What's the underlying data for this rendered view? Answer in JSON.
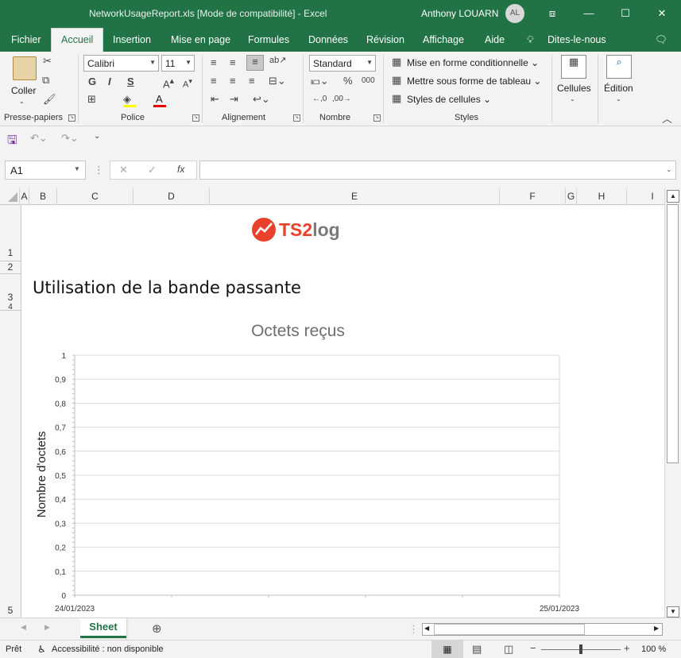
{
  "window": {
    "title": "NetworkUsageReport.xls  [Mode de compatibilité]  -  Excel",
    "user_name": "Anthony LOUARN",
    "user_initials": "AL"
  },
  "menu": {
    "tabs": [
      {
        "label": "Fichier"
      },
      {
        "label": "Accueil",
        "active": true
      },
      {
        "label": "Insertion"
      },
      {
        "label": "Mise en page"
      },
      {
        "label": "Formules"
      },
      {
        "label": "Données"
      },
      {
        "label": "Révision"
      },
      {
        "label": "Affichage"
      },
      {
        "label": "Aide"
      },
      {
        "label": "Dites-le-nous"
      }
    ]
  },
  "ribbon": {
    "clipboard": {
      "paste_label": "Coller",
      "group_label": "Presse-papiers"
    },
    "font": {
      "font_name": "Calibri",
      "font_size": "11",
      "bold": "G",
      "italic": "I",
      "underline": "S",
      "group_label": "Police"
    },
    "alignment": {
      "group_label": "Alignement"
    },
    "number": {
      "format": "Standard",
      "group_label": "Nombre"
    },
    "styles": {
      "conditional_label": "Mise en forme conditionnelle",
      "table_label": "Mettre sous forme de tableau",
      "cell_styles_label": "Styles de cellules",
      "group_label": "Styles"
    },
    "cells_label": "Cellules",
    "editing_label": "Édition"
  },
  "formula_bar": {
    "name_box": "A1",
    "fx": "fx",
    "formula": ""
  },
  "grid": {
    "columns": [
      "A",
      "B",
      "C",
      "D",
      "E",
      "F",
      "G",
      "H",
      "I"
    ],
    "rows": [
      "1",
      "2",
      "3",
      "4",
      "5"
    ],
    "logo_text": "TS2log",
    "heading": "Utilisation de la bande passante"
  },
  "chart_data": {
    "type": "line",
    "title": "Octets reçus",
    "ylabel": "Nombre d'octets",
    "xlabel": "",
    "ylim": [
      0,
      1
    ],
    "yticks": [
      "0",
      "0,1",
      "0,2",
      "0,3",
      "0,4",
      "0,5",
      "0,6",
      "0,7",
      "0,8",
      "0,9",
      "1"
    ],
    "x": [
      "24/01/2023",
      "25/01/2023"
    ],
    "series": [],
    "grid": true,
    "legend": "none"
  },
  "sheet_tabs": [
    {
      "label": "Sheet",
      "active": true
    }
  ],
  "status": {
    "ready": "Prêt",
    "accessibility": "Accessibilité : non disponible",
    "zoom": "100 %"
  },
  "colors": {
    "excel_green": "#217346",
    "logo_orange": "#e8412c",
    "logo_gray": "#7a7a7a"
  }
}
